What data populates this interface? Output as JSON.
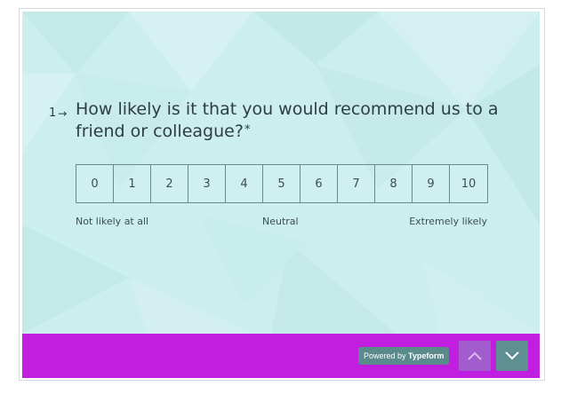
{
  "question": {
    "number": "1",
    "arrow_icon": "right-arrow-icon",
    "text": "How likely is it that you would recommend us to a friend or colleague?",
    "required_marker": "*"
  },
  "scale": {
    "options": [
      "0",
      "1",
      "2",
      "3",
      "4",
      "5",
      "6",
      "7",
      "8",
      "9",
      "10"
    ],
    "label_low": "Not likely at all",
    "label_mid": "Neutral",
    "label_high": "Extremely likely"
  },
  "footer": {
    "powered_prefix": "Powered by ",
    "powered_brand": "Typeform",
    "up_icon": "chevron-up-icon",
    "down_icon": "chevron-down-icon",
    "background_color": "#c01fe0"
  },
  "colors": {
    "background": "#cdeeee",
    "text": "#2e3d43",
    "border": "#6b8a90"
  }
}
